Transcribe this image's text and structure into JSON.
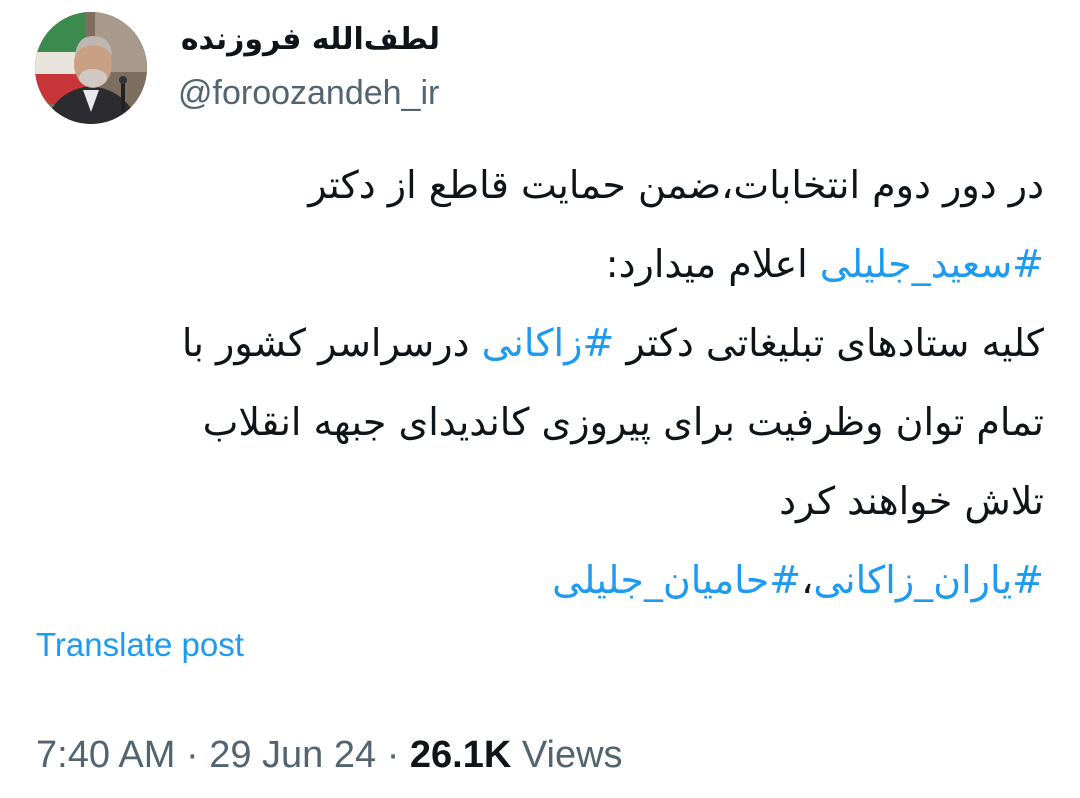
{
  "author": {
    "display_name": "لطف‌الله فروزنده",
    "handle": "@foroozandeh_ir"
  },
  "post": {
    "lines": [
      [
        {
          "text": "در دور دوم انتخابات،ضمن حمایت قاطع از دکتر",
          "hashtag": false
        }
      ],
      [
        {
          "text": "#سعید_جلیلی",
          "hashtag": true
        },
        {
          "text": " اعلام میدارد:",
          "hashtag": false
        }
      ],
      [
        {
          "text": "کلیه ستادهای تبلیغاتی دکتر ",
          "hashtag": false
        },
        {
          "text": "#زاکانی",
          "hashtag": true
        },
        {
          "text": " درسراسر کشور با",
          "hashtag": false
        }
      ],
      [
        {
          "text": "تمام توان وظرفیت برای پیروزی کاندیدای جبهه انقلاب",
          "hashtag": false
        }
      ],
      [
        {
          "text": "تلاش خواهند کرد",
          "hashtag": false
        }
      ],
      [
        {
          "text": "#یاران_زاکانی",
          "hashtag": true
        },
        {
          "text": "،",
          "hashtag": false
        },
        {
          "text": "#حامیان_جلیلی",
          "hashtag": true
        }
      ]
    ]
  },
  "translate_label": "Translate post",
  "meta": {
    "time": "7:40 AM",
    "separator": "·",
    "date": "29 Jun 24",
    "views_count": "26.1K",
    "views_label": "Views"
  },
  "colors": {
    "link": "#1d9bf0",
    "text": "#0f1419",
    "muted": "#536471"
  }
}
